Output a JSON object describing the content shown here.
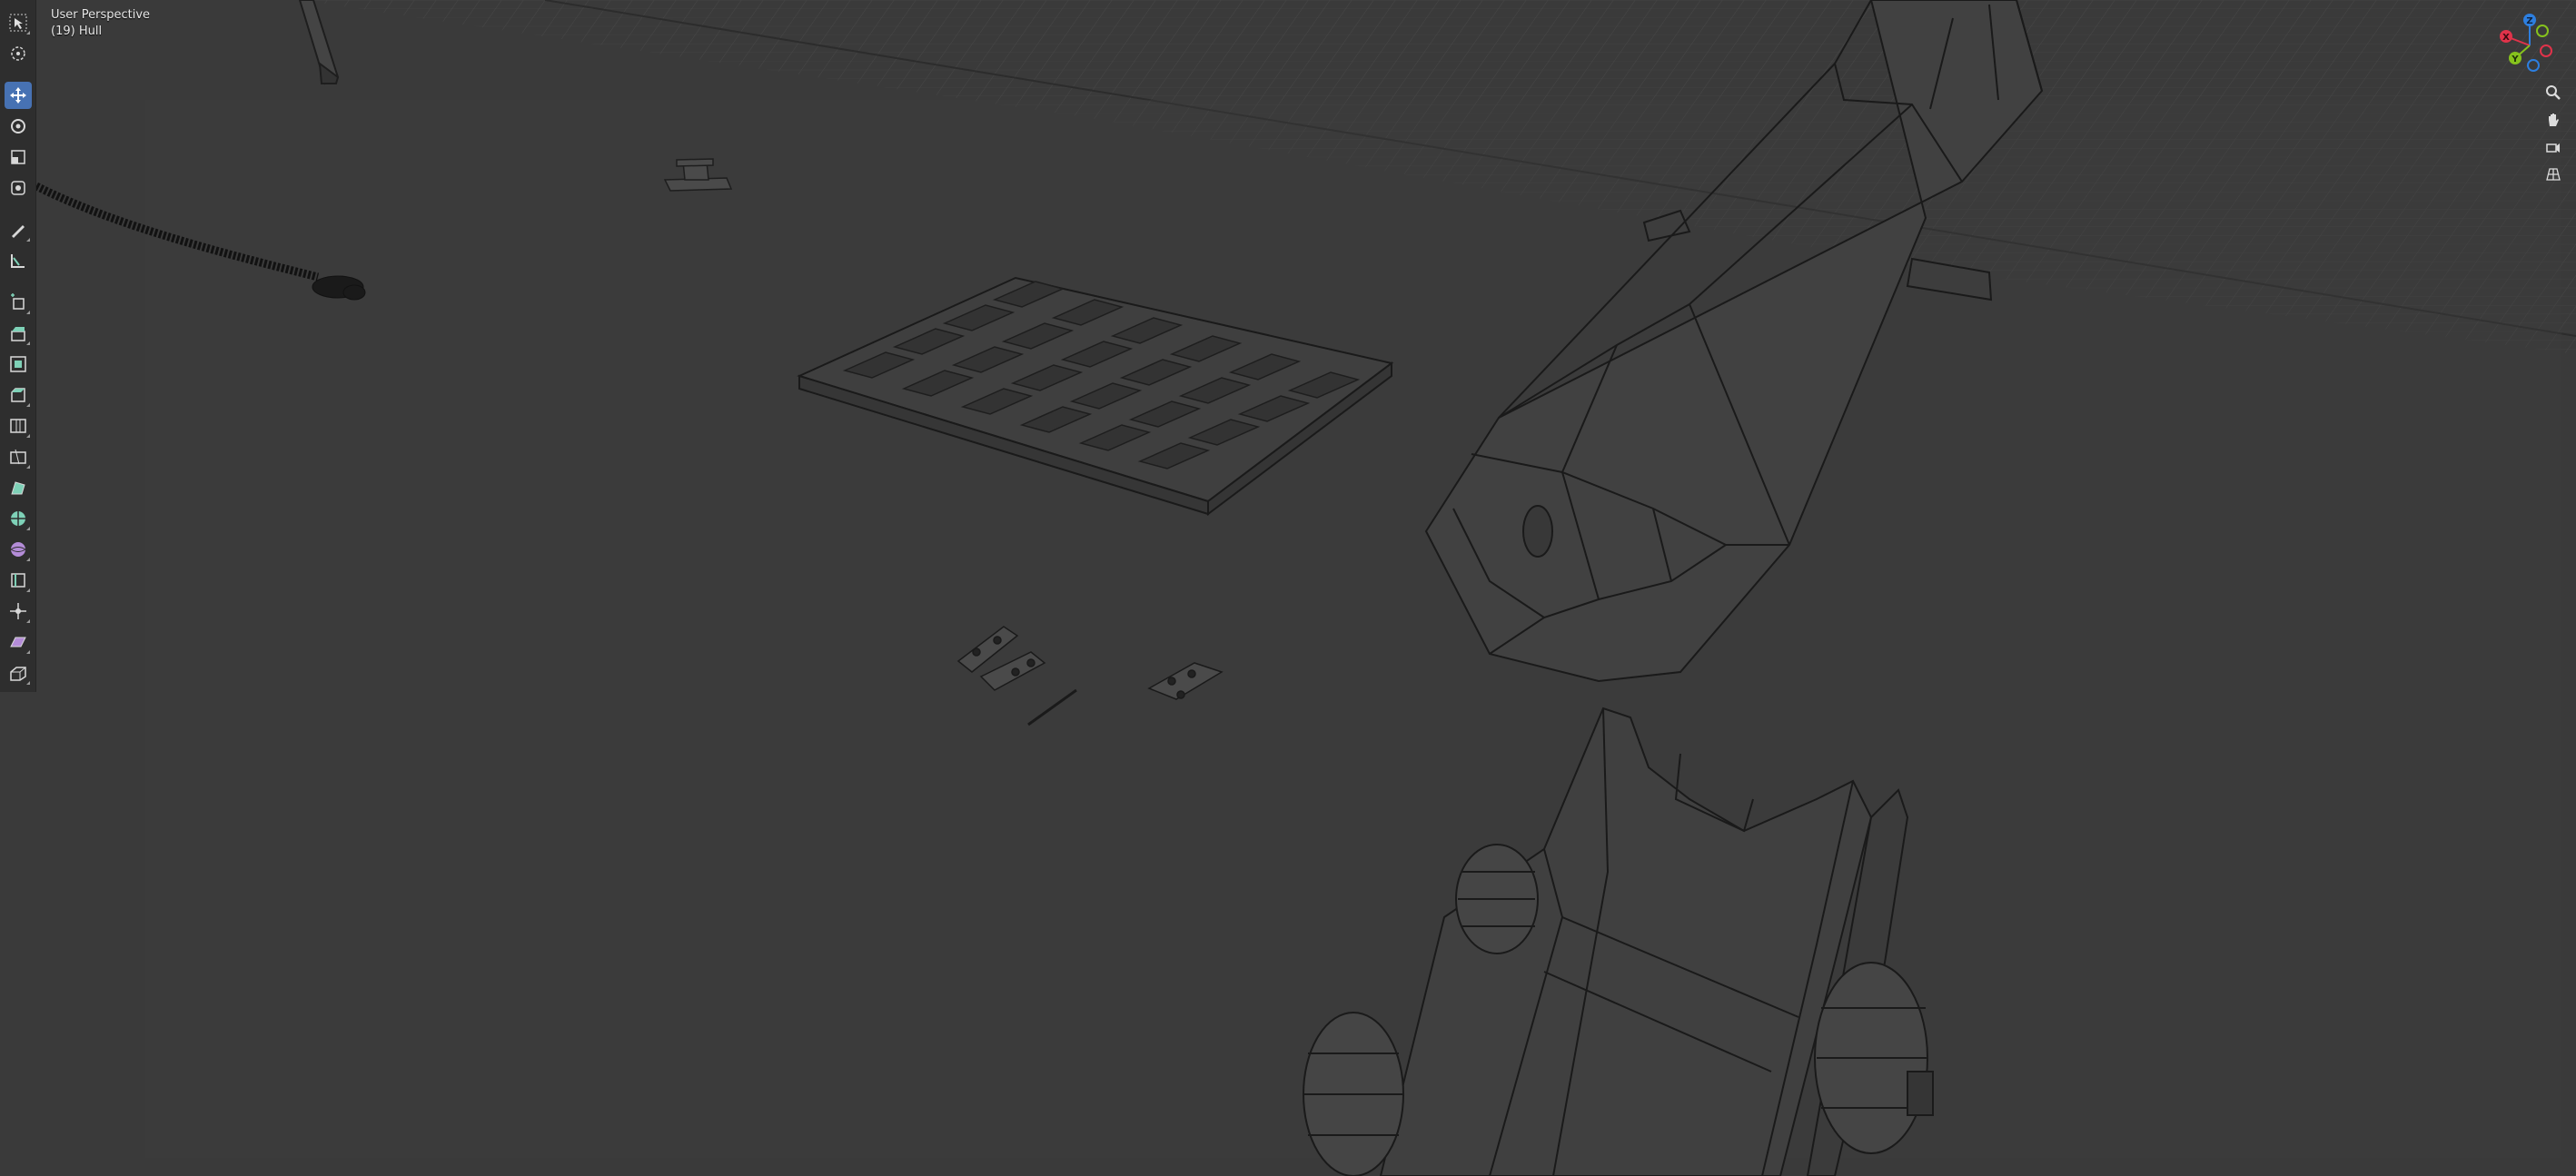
{
  "viewport": {
    "view_name": "User Perspective",
    "collection_line": "(19) Hull"
  },
  "toolbar": {
    "active_tool": "move",
    "tools": [
      {
        "name": "select-box",
        "icon": "select-box-icon"
      },
      {
        "name": "cursor",
        "icon": "cursor-icon"
      },
      {
        "name": "move",
        "icon": "move-icon"
      },
      {
        "name": "rotate",
        "icon": "rotate-icon"
      },
      {
        "name": "scale",
        "icon": "scale-icon"
      },
      {
        "name": "transform",
        "icon": "transform-icon"
      },
      {
        "name": "annotate",
        "icon": "annotate-icon"
      },
      {
        "name": "measure",
        "icon": "measure-icon"
      },
      {
        "name": "add-cube",
        "icon": "add-cube-icon"
      },
      {
        "name": "extrude-region",
        "icon": "extrude-icon"
      },
      {
        "name": "inset-faces",
        "icon": "inset-icon"
      },
      {
        "name": "bevel",
        "icon": "bevel-icon"
      },
      {
        "name": "loop-cut",
        "icon": "loop-cut-icon"
      },
      {
        "name": "knife",
        "icon": "knife-icon"
      },
      {
        "name": "poly-build",
        "icon": "poly-build-icon"
      },
      {
        "name": "spin",
        "icon": "spin-icon"
      },
      {
        "name": "smooth",
        "icon": "smooth-icon"
      },
      {
        "name": "edge-slide",
        "icon": "edge-slide-icon"
      },
      {
        "name": "shrink-fatten",
        "icon": "shrink-fatten-icon"
      },
      {
        "name": "shear",
        "icon": "shear-icon"
      },
      {
        "name": "rip-region",
        "icon": "rip-icon"
      }
    ]
  },
  "gizmo": {
    "axes": [
      {
        "label": "Z",
        "color": "#2d7fe0"
      },
      {
        "label": "X",
        "color": "#e0334a"
      },
      {
        "label": "Y",
        "color": "#86c21d"
      }
    ]
  },
  "nav_buttons": [
    {
      "icon": "zoom-icon"
    },
    {
      "icon": "pan-hand-icon"
    },
    {
      "icon": "camera-icon"
    },
    {
      "icon": "grid-perspective-icon"
    }
  ],
  "colors": {
    "background": "#3a3a3a",
    "toolbar": "#2e2e2e",
    "active_tool": "#4772b3",
    "wire": "#1a1a1a",
    "grid": "#4a4a4a"
  }
}
